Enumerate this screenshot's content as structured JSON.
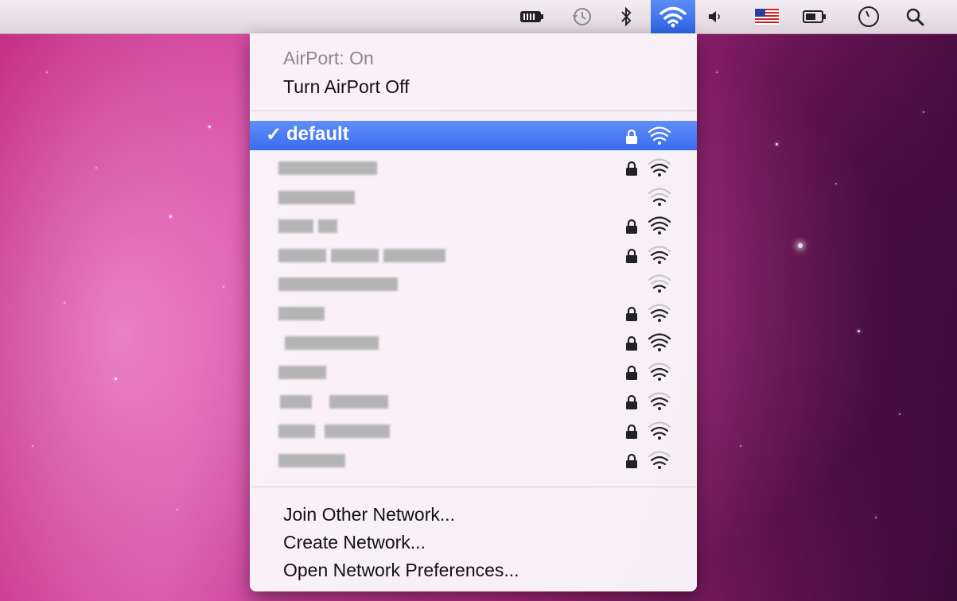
{
  "menubar": {
    "icons": [
      "battery-percentage-icon",
      "time-machine-icon",
      "bluetooth-icon",
      "wifi-icon",
      "volume-icon",
      "us-flag-input-icon",
      "battery-icon",
      "clock-icon",
      "spotlight-search-icon"
    ],
    "wifi_highlight_color": "#3b6cf0"
  },
  "menu": {
    "status": "AirPort: On",
    "toggle": "Turn AirPort Off",
    "networks": [
      {
        "name": "default",
        "selected": true,
        "check": "✓",
        "secured": true,
        "signal": 3
      },
      {
        "name": "",
        "secured": true,
        "signal": 2
      },
      {
        "name": "",
        "secured": false,
        "signal": 1
      },
      {
        "name": "",
        "secured": true,
        "signal": 3
      },
      {
        "name": "",
        "secured": true,
        "signal": 2
      },
      {
        "name": "",
        "secured": false,
        "signal": 1
      },
      {
        "name": "",
        "secured": true,
        "signal": 2
      },
      {
        "name": "",
        "secured": true,
        "signal": 3
      },
      {
        "name": "",
        "secured": true,
        "signal": 2
      },
      {
        "name": "",
        "secured": true,
        "signal": 2
      },
      {
        "name": "",
        "secured": true,
        "signal": 2
      },
      {
        "name": "",
        "secured": true,
        "signal": 2
      }
    ],
    "join_other": "Join Other Network...",
    "create": "Create Network...",
    "preferences": "Open Network Preferences..."
  }
}
